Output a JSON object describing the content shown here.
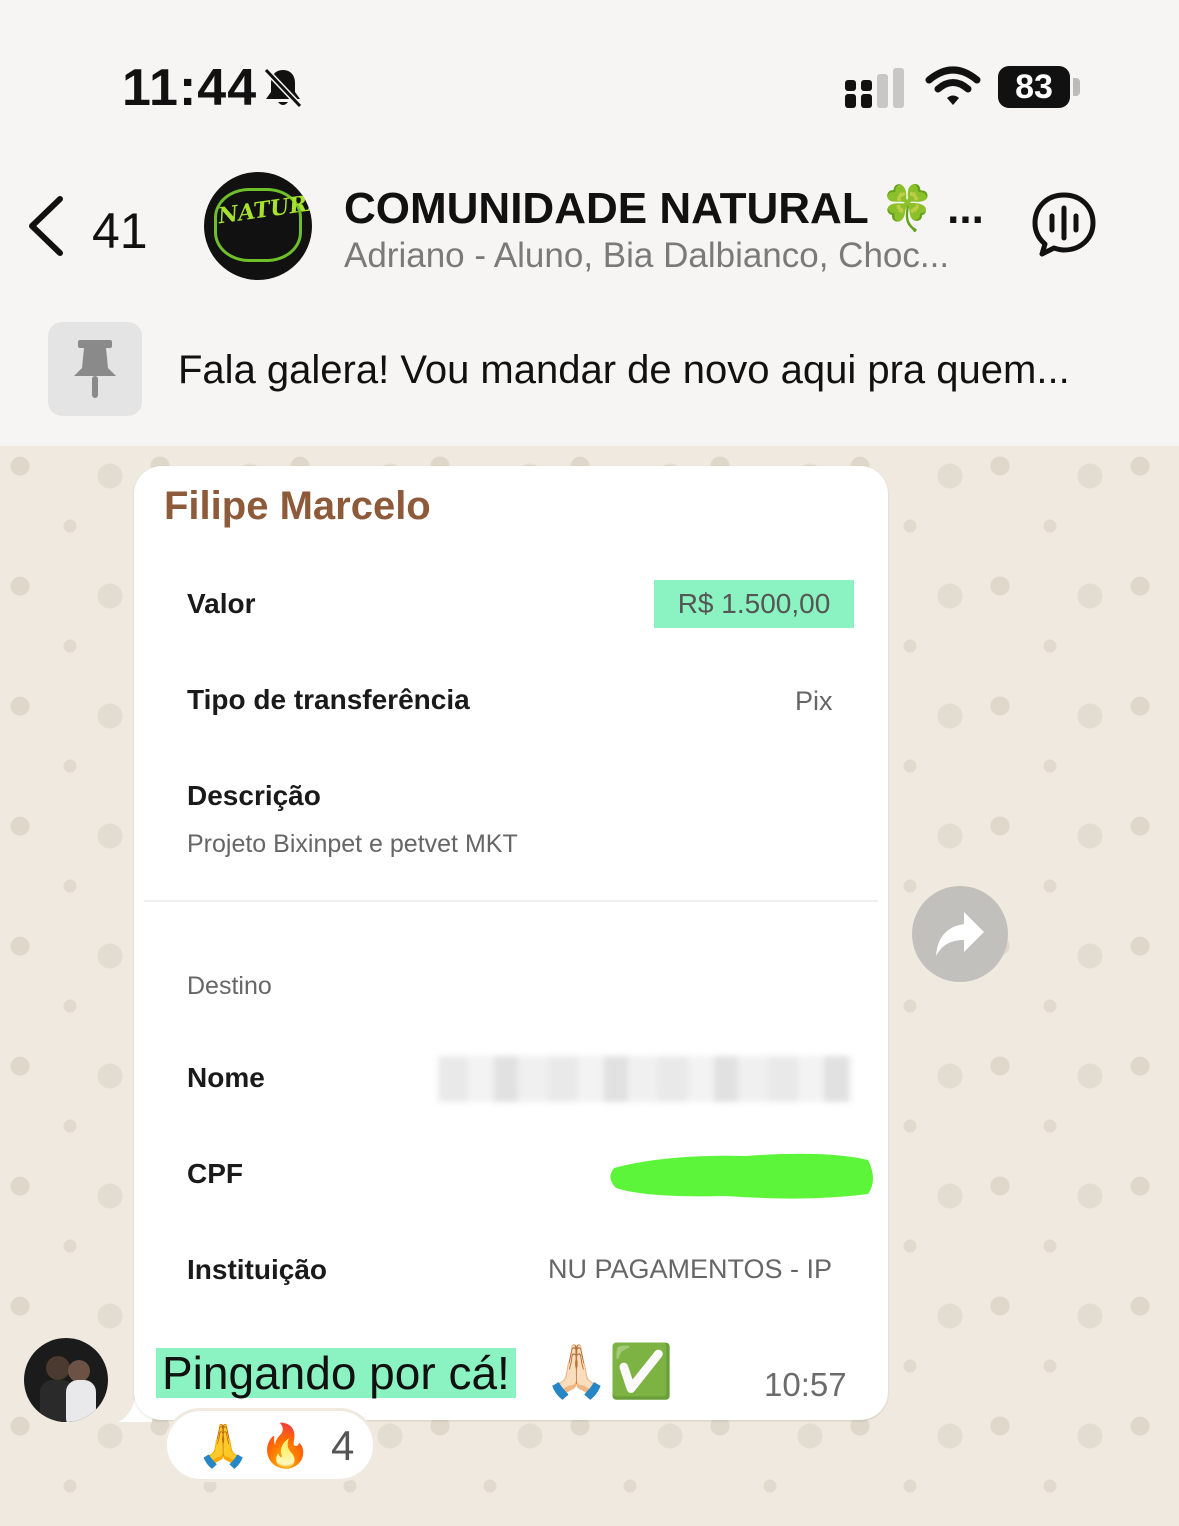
{
  "status_bar": {
    "time": "11:44",
    "battery": "83"
  },
  "header": {
    "back_count": "41",
    "group_name": "COMUNIDADE NATURAL 🍀 ...",
    "avatar_text": "NATURAL",
    "members": "Adriano - Aluno, Bia Dalbianco, Choc..."
  },
  "pinned": {
    "text": "Fala galera! Vou mandar de novo aqui pra quem..."
  },
  "message": {
    "sender": "Filipe Marcelo",
    "receipt": {
      "valor_label": "Valor",
      "valor_value": "R$ 1.500,00",
      "tipo_label": "Tipo de transferência",
      "tipo_value": "Pix",
      "descricao_label": "Descrição",
      "descricao_value": "Projeto Bixinpet e petvet MKT",
      "destino_label": "Destino",
      "nome_label": "Nome",
      "cpf_label": "CPF",
      "instituicao_label": "Instituição",
      "instituicao_value": "NU PAGAMENTOS - IP"
    },
    "caption": "Pingando por cá!",
    "caption_emoji": "🙏🏻✅",
    "time": "10:57",
    "reactions": {
      "first": "🙏",
      "second": "🔥",
      "count": "4"
    }
  },
  "colors": {
    "sender_name": "#8d5a3a",
    "highlight": "#8af3c1",
    "cpf_scribble": "#5cf53a",
    "chat_background": "#efeae2"
  },
  "icons": [
    "bell-off-icon",
    "signal-icon",
    "wifi-icon",
    "battery-icon",
    "back-chevron-icon",
    "call-icon",
    "pin-icon",
    "forward-icon"
  ]
}
